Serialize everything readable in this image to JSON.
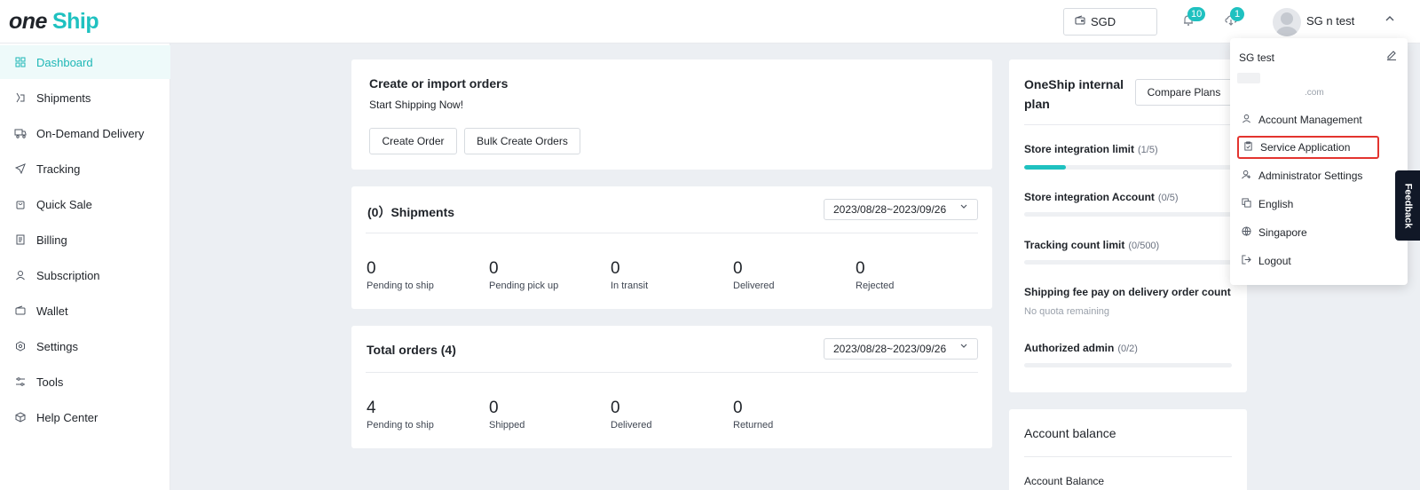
{
  "header": {
    "logo_part1": "one",
    "logo_part2": "Ship",
    "currency": "SGD",
    "notifications_count": "10",
    "downloads_count": "1",
    "user_name": "SG     n test"
  },
  "sidebar": {
    "items": [
      {
        "label": "Dashboard",
        "icon": "dashboard-icon",
        "active": true
      },
      {
        "label": "Shipments",
        "icon": "shipments-icon"
      },
      {
        "label": "On-Demand Delivery",
        "icon": "truck-icon"
      },
      {
        "label": "Tracking",
        "icon": "navigation-icon"
      },
      {
        "label": "Quick Sale",
        "icon": "bag-icon"
      },
      {
        "label": "Billing",
        "icon": "receipt-icon"
      },
      {
        "label": "Subscription",
        "icon": "user-icon"
      },
      {
        "label": "Wallet",
        "icon": "wallet-icon"
      },
      {
        "label": "Settings",
        "icon": "gear-icon"
      },
      {
        "label": "Tools",
        "icon": "tools-icon"
      },
      {
        "label": "Help Center",
        "icon": "box-icon"
      }
    ]
  },
  "create_card": {
    "title": "Create or import orders",
    "subtitle": "Start Shipping Now!",
    "create_btn": "Create Order",
    "bulk_btn": "Bulk Create Orders"
  },
  "shipments_card": {
    "title": "(0）Shipments",
    "date_range": "2023/08/28~2023/09/26",
    "stats": [
      {
        "value": "0",
        "label": "Pending to ship"
      },
      {
        "value": "0",
        "label": "Pending pick up"
      },
      {
        "value": "0",
        "label": "In transit"
      },
      {
        "value": "0",
        "label": "Delivered"
      },
      {
        "value": "0",
        "label": "Rejected"
      }
    ]
  },
  "orders_card": {
    "title": "Total orders (4)",
    "date_range": "2023/08/28~2023/09/26",
    "stats": [
      {
        "value": "4",
        "label": "Pending to ship"
      },
      {
        "value": "0",
        "label": "Shipped"
      },
      {
        "value": "0",
        "label": "Delivered"
      },
      {
        "value": "0",
        "label": "Returned"
      }
    ]
  },
  "plan_card": {
    "title_line1": "OneShip internal",
    "title_line2": "plan",
    "compare_btn": "Compare Plans",
    "limits": [
      {
        "label": "Store integration limit",
        "sub": "(1/5)",
        "fraction": 0.2
      },
      {
        "label": "Store integration Account",
        "sub": "(0/5)",
        "fraction": 0
      },
      {
        "label": "Tracking count limit",
        "sub": "(0/500)",
        "fraction": 0
      }
    ],
    "fee_label": "Shipping fee pay on delivery order count",
    "fee_note": "No quota remaining",
    "admin_label": "Authorized admin",
    "admin_sub": "(0/2)",
    "admin_fraction": 0
  },
  "balance_card": {
    "title": "Account balance",
    "label": "Account Balance"
  },
  "dropdown": {
    "name": "SG        test",
    "email_suffix": ".com",
    "items": [
      {
        "label": "Account Management",
        "icon": "user-icon"
      },
      {
        "label": "Service Application",
        "icon": "clipboard-icon",
        "highlight": true
      },
      {
        "label": "Administrator Settings",
        "icon": "admin-icon"
      },
      {
        "label": "English",
        "icon": "language-icon",
        "submenu": true
      },
      {
        "label": "Singapore",
        "icon": "globe-icon"
      },
      {
        "label": "Logout",
        "icon": "logout-icon"
      }
    ]
  },
  "feedback": "Feedback",
  "colors": {
    "accent": "#1fc1c0",
    "highlight_border": "#e3342f"
  }
}
